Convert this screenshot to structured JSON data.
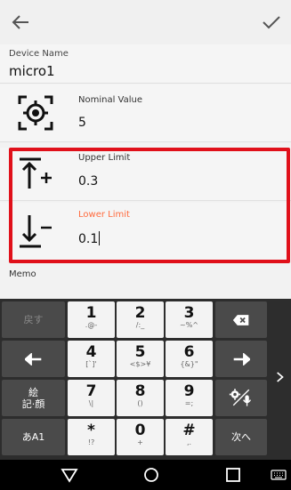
{
  "appbar": {
    "back_icon": "arrow-left-icon",
    "confirm_icon": "check-icon"
  },
  "device": {
    "label": "Device Name",
    "value": "micro1"
  },
  "nominal": {
    "label": "Nominal Value",
    "value": "5",
    "icon": "target-icon"
  },
  "upper": {
    "label": "Upper Limit",
    "value": "0.3",
    "icon": "upper-limit-icon"
  },
  "lower": {
    "label": "Lower Limit",
    "value": "0.1",
    "icon": "lower-limit-icon",
    "label_color": "#ff6a3d"
  },
  "memo": {
    "label": "Memo"
  },
  "highlight_color": "#e0101a",
  "keyboard": {
    "rows": [
      {
        "left": "戻す",
        "keys": [
          {
            "main": "1",
            "sub": ".@-"
          },
          {
            "main": "2",
            "sub": "/:_"
          },
          {
            "main": "3",
            "sub": "~%^"
          }
        ],
        "right_icon": "backspace-icon"
      },
      {
        "left_icon": "arrow-left-icon",
        "keys": [
          {
            "main": "4",
            "sub": "[`]'"
          },
          {
            "main": "5",
            "sub": "<$>¥"
          },
          {
            "main": "6",
            "sub": "{&}\""
          }
        ],
        "right_icon": "arrow-right-icon"
      },
      {
        "left": "絵\n記·顔",
        "keys": [
          {
            "main": "7",
            "sub": "\\|"
          },
          {
            "main": "8",
            "sub": "()"
          },
          {
            "main": "9",
            "sub": "=;"
          }
        ],
        "right_icon": "settings-mic-icon"
      },
      {
        "left": "あA1",
        "keys": [
          {
            "main": "*",
            "sub": "!?"
          },
          {
            "main": "0",
            "sub": "+"
          },
          {
            "main": "#",
            "sub": ",."
          }
        ],
        "right": "次へ"
      }
    ],
    "side_icon": "chevron-right-icon"
  },
  "navbar": {
    "back": "triangle-back-icon",
    "home": "circle-home-icon",
    "recents": "square-recents-icon",
    "keyboard": "keyboard-icon"
  }
}
